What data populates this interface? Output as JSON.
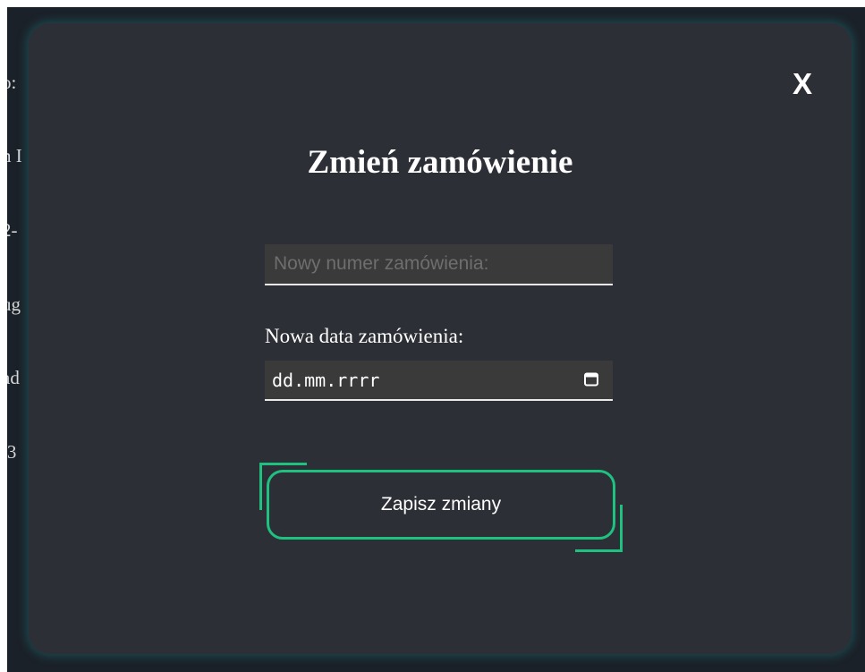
{
  "background": {
    "fragments": [
      "o:",
      "n I",
      "2-",
      "ug",
      "ad",
      "i3"
    ]
  },
  "modal": {
    "close_label": "X",
    "title": "Zmień zamówienie",
    "order_number": {
      "placeholder": "Nowy numer zamówienia:",
      "value": ""
    },
    "order_date": {
      "label": "Nowa data zamówienia:",
      "value": "dd.mm.rrrr"
    },
    "save_label": "Zapisz zmiany"
  },
  "icons": {
    "calendar": "calendar-icon",
    "close": "close-icon"
  },
  "colors": {
    "accent": "#1fc181",
    "modal_bg": "#2d2f36",
    "page_bg": "#1b2128",
    "glow": "#208c96"
  }
}
